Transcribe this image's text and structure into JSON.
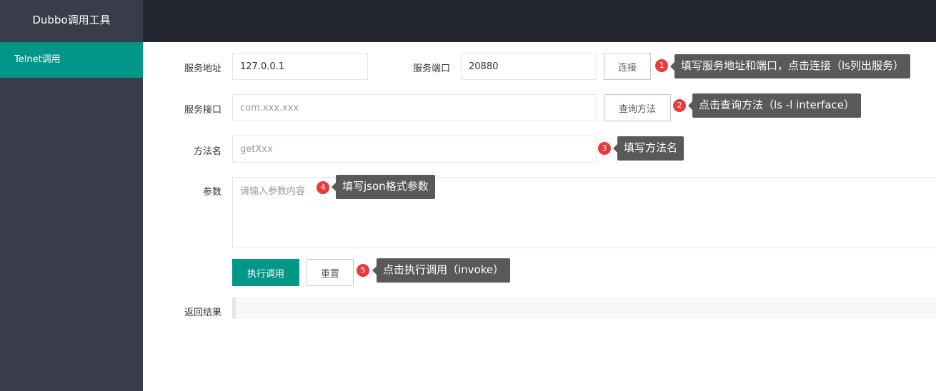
{
  "app": {
    "title": "Dubbo调用工具"
  },
  "sidebar": {
    "items": [
      {
        "label": "Telnet调用",
        "active": true
      }
    ]
  },
  "form": {
    "address_label": "服务地址",
    "address_value": "127.0.0.1",
    "port_label": "服务端口",
    "port_value": "20880",
    "connect_button": "连接",
    "interface_label": "服务接口",
    "interface_placeholder": "com.xxx.xxx",
    "query_button": "查询方法",
    "method_label": "方法名",
    "method_placeholder": "getXxx",
    "params_label": "参数",
    "params_placeholder": "请输入参数内容",
    "invoke_button": "执行调用",
    "reset_button": "重置",
    "result_label": "返回结果",
    "result_value": ""
  },
  "annotations": [
    {
      "number": "1",
      "text": "填写服务地址和端口，点击连接（ls列出服务）"
    },
    {
      "number": "2",
      "text": "点击查询方法（ls -l interface）"
    },
    {
      "number": "3",
      "text": "填写方法名"
    },
    {
      "number": "4",
      "text": "填写json格式参数"
    },
    {
      "number": "5",
      "text": "点击执行调用（invoke）"
    }
  ],
  "colors": {
    "sidebar": "#393d49",
    "topbar": "#23262e",
    "accent": "#009688",
    "badge": "#e83a3a",
    "tooltip": "#595959"
  }
}
